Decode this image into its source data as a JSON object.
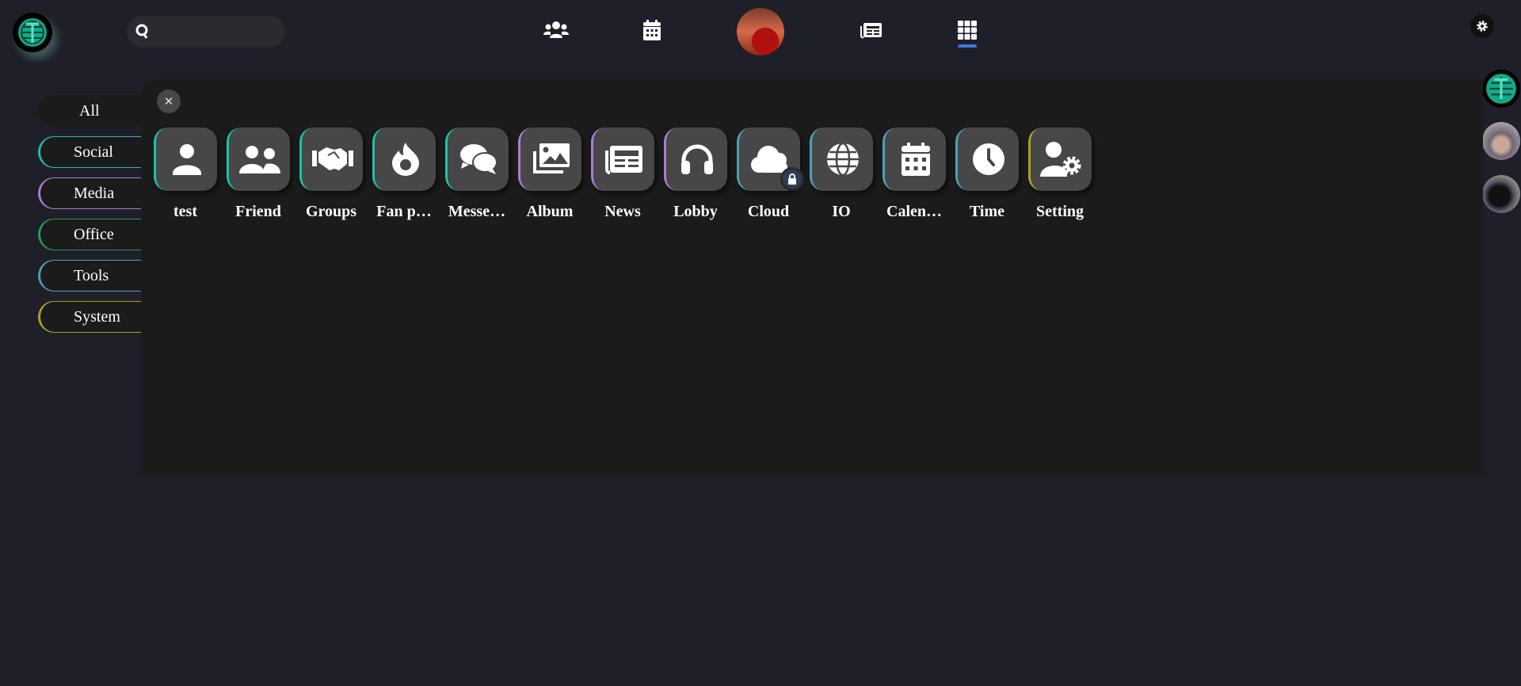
{
  "header": {
    "search_placeholder": "",
    "nav": [
      "friends",
      "calendar",
      "profile",
      "news",
      "apps"
    ],
    "active_nav": "apps"
  },
  "sidebar": {
    "items": [
      {
        "label": "All",
        "color": "#1b1b1b"
      },
      {
        "label": "Social",
        "color": "#1fbfaf"
      },
      {
        "label": "Media",
        "color": "#a67fd0"
      },
      {
        "label": "Office",
        "color": "#2e9a56"
      },
      {
        "label": "Tools",
        "color": "#4fa0b8"
      },
      {
        "label": "System",
        "color": "#b0a020"
      }
    ]
  },
  "apps": [
    {
      "label": "test",
      "icon": "user-icon",
      "color": "#1fbfaf"
    },
    {
      "label": "Friend",
      "icon": "users-icon",
      "color": "#1fbfaf"
    },
    {
      "label": "Groups",
      "icon": "handshake-icon",
      "color": "#1fbfaf"
    },
    {
      "label": "Fan p…",
      "icon": "fire-icon",
      "color": "#1fbfaf"
    },
    {
      "label": "Messe…",
      "icon": "comments-icon",
      "color": "#1fbfaf"
    },
    {
      "label": "Album",
      "icon": "images-icon",
      "color": "#a67fd0"
    },
    {
      "label": "News",
      "icon": "newspaper-icon",
      "color": "#a67fd0"
    },
    {
      "label": "Lobby",
      "icon": "headphones-icon",
      "color": "#a67fd0"
    },
    {
      "label": "Cloud",
      "icon": "cloud-icon",
      "color": "#4fa0b8",
      "locked": true
    },
    {
      "label": "IO",
      "icon": "globe-icon",
      "color": "#4fa0b8"
    },
    {
      "label": "Calen…",
      "icon": "calendar-icon",
      "color": "#4fa0b8"
    },
    {
      "label": "Time",
      "icon": "clock-icon",
      "color": "#4fa0b8"
    },
    {
      "label": "Setting",
      "icon": "user-gear-icon",
      "color": "#b0a020"
    }
  ]
}
